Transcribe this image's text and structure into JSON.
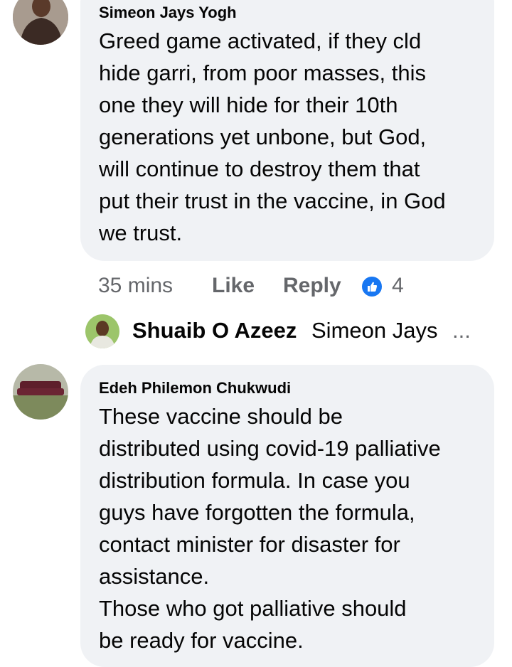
{
  "comments": [
    {
      "author": "Simeon Jays Yogh",
      "text": "Greed game activated, if they cld\nhide garri, from poor masses, this\none they will hide for their 10th\ngenerations yet unbone, but God,\nwill continue to destroy them that\nput their trust in the vaccine, in God\nwe trust.",
      "time": "35 mins",
      "like_label": "Like",
      "reply_label": "Reply",
      "reaction_count": "4",
      "reaction_icon": "thumbs-up-icon",
      "reply_preview": {
        "author": "Shuaib O Azeez",
        "text": "Simeon Jays",
        "ellipsis": "..."
      }
    },
    {
      "author": "Edeh Philemon Chukwudi",
      "text": "These vaccine should be\ndistributed using covid-19 palliative\ndistribution formula. In case you\nguys have forgotten the formula,\ncontact minister for disaster for\nassistance.\n   Those who got palliative should\nbe ready for vaccine."
    }
  ],
  "colors": {
    "bubble": "#f0f2f5",
    "text": "#050505",
    "meta": "#65676b",
    "like_blue": "#1877f2"
  }
}
